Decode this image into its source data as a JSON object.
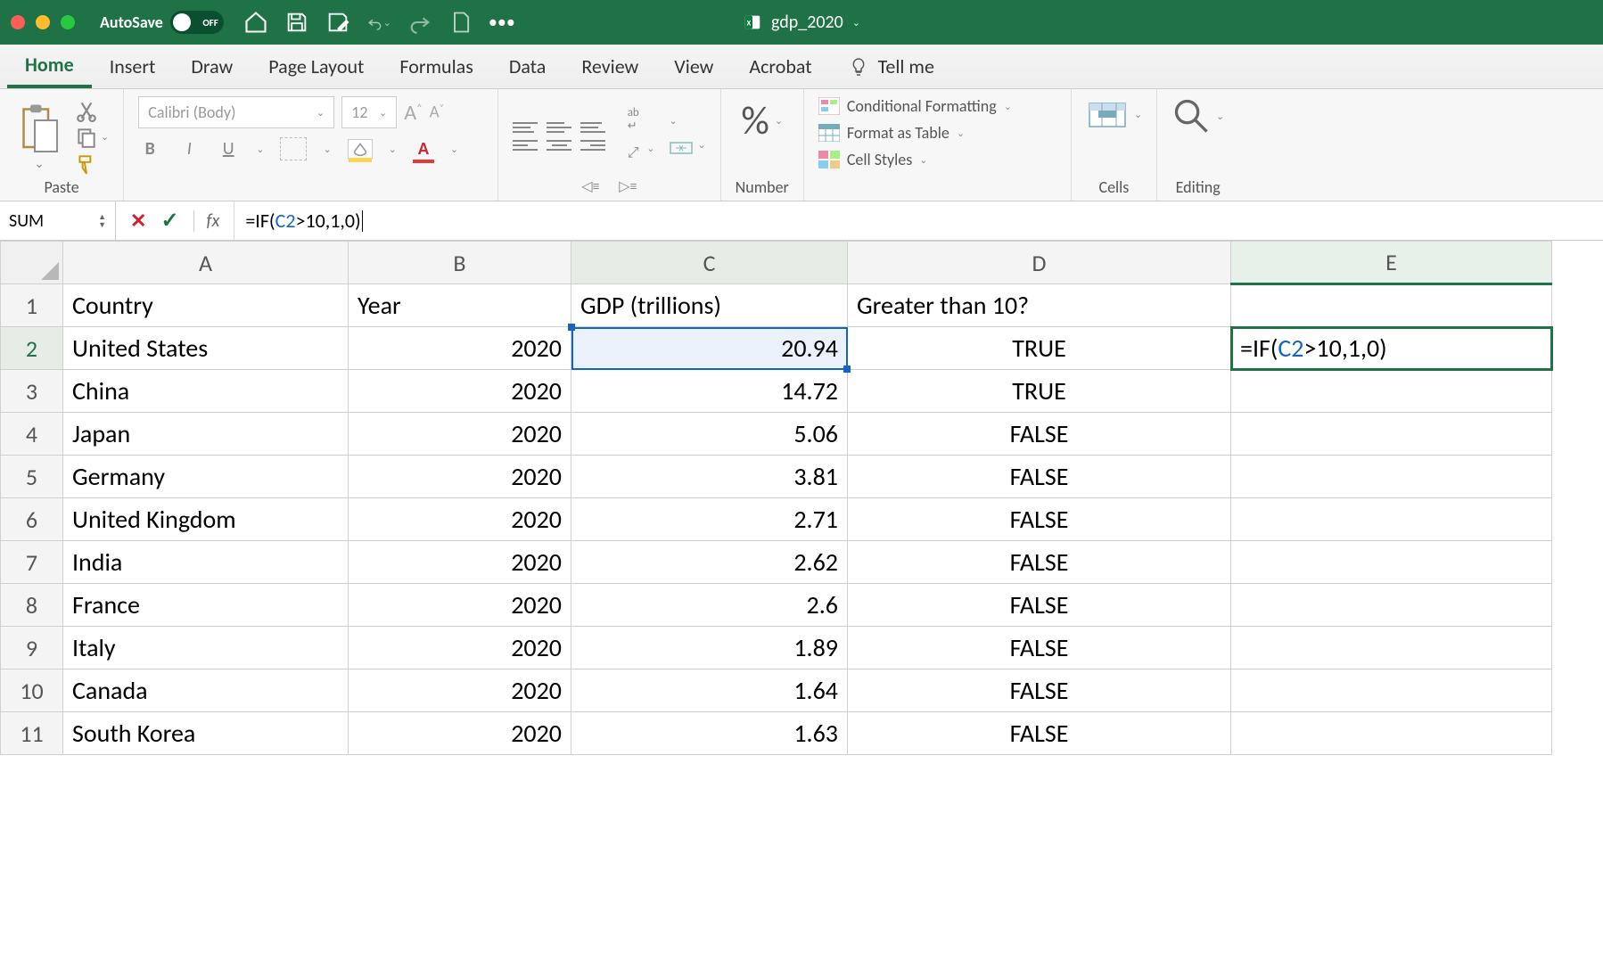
{
  "titlebar": {
    "autosave_label": "AutoSave",
    "autosave_state": "OFF",
    "filename": "gdp_2020"
  },
  "tabs": [
    "Home",
    "Insert",
    "Draw",
    "Page Layout",
    "Formulas",
    "Data",
    "Review",
    "View",
    "Acrobat"
  ],
  "active_tab": "Home",
  "tellme": "Tell me",
  "ribbon": {
    "paste": "Paste",
    "font_name": "Calibri (Body)",
    "font_size": "12",
    "number": "Number",
    "cond_fmt": "Conditional Formatting",
    "fmt_table": "Format as Table",
    "cell_styles": "Cell Styles",
    "cells": "Cells",
    "editing": "Editing"
  },
  "formula_bar": {
    "name_box": "SUM",
    "formula_prefix": "=IF(",
    "formula_ref": "C2",
    "formula_suffix": ">10,1,0)"
  },
  "columns": [
    "A",
    "B",
    "C",
    "D",
    "E"
  ],
  "headers": {
    "A": "Country",
    "B": "Year",
    "C": "GDP (trillions)",
    "D": "Greater than 10?",
    "E": ""
  },
  "rows": [
    {
      "n": "1"
    },
    {
      "n": "2",
      "A": "United States",
      "B": "2020",
      "C": "20.94",
      "D": "TRUE"
    },
    {
      "n": "3",
      "A": "China",
      "B": "2020",
      "C": "14.72",
      "D": "TRUE"
    },
    {
      "n": "4",
      "A": "Japan",
      "B": "2020",
      "C": "5.06",
      "D": "FALSE"
    },
    {
      "n": "5",
      "A": "Germany",
      "B": "2020",
      "C": "3.81",
      "D": "FALSE"
    },
    {
      "n": "6",
      "A": "United Kingdom",
      "B": "2020",
      "C": "2.71",
      "D": "FALSE"
    },
    {
      "n": "7",
      "A": "India",
      "B": "2020",
      "C": "2.62",
      "D": "FALSE"
    },
    {
      "n": "8",
      "A": "France",
      "B": "2020",
      "C": "2.6",
      "D": "FALSE"
    },
    {
      "n": "9",
      "A": "Italy",
      "B": "2020",
      "C": "1.89",
      "D": "FALSE"
    },
    {
      "n": "10",
      "A": "Canada",
      "B": "2020",
      "C": "1.64",
      "D": "FALSE"
    },
    {
      "n": "11",
      "A": "South Korea",
      "B": "2020",
      "C": "1.63",
      "D": "FALSE"
    }
  ],
  "editing_cell": {
    "prefix": "=IF(",
    "ref": "C2",
    "suffix": ">10,1,0)"
  }
}
